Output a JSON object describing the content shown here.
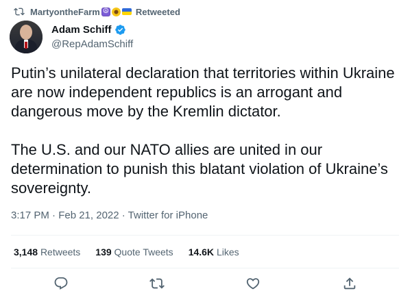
{
  "retweet_context": {
    "user": "MartyontheFarm",
    "emojis": [
      "peace-emoji-icon",
      "sunflower-emoji-icon",
      "ukraine-flag-emoji-icon"
    ],
    "label": "Retweeted"
  },
  "author": {
    "display_name": "Adam Schiff",
    "handle": "@RepAdamSchiff",
    "verified": true
  },
  "tweet": {
    "paragraph1": "Putin’s unilateral declaration that territories within Ukraine are now independent republics is an arrogant and dangerous move by the Kremlin dictator.",
    "paragraph2": "The U.S. and our NATO allies are united in our determination to punish this blatant violation of Ukraine’s sovereignty.",
    "meta": "3:17 PM · Feb 21, 2022 · Twitter for iPhone"
  },
  "stats": {
    "retweets_count": "3,148",
    "retweets_label": "Retweets",
    "quotes_count": "139",
    "quotes_label": "Quote Tweets",
    "likes_count": "14.6K",
    "likes_label": "Likes"
  },
  "actions": [
    "reply-icon",
    "retweet-icon",
    "like-icon",
    "share-icon"
  ],
  "colors": {
    "text": "#0f1419",
    "secondary": "#536471",
    "verified": "#1d9bf0",
    "divider": "#eff3f4"
  }
}
